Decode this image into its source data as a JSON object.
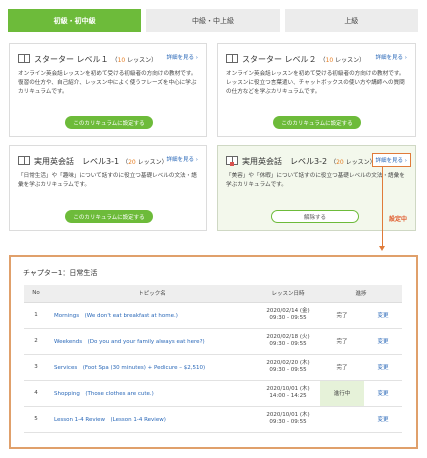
{
  "tabs": [
    {
      "label": "初級・初中級",
      "active": true
    },
    {
      "label": "中級・中上級",
      "active": false
    },
    {
      "label": "上級",
      "active": false
    }
  ],
  "cards": [
    {
      "title": "スターター レベル１",
      "lessons_open": "（",
      "lessons_num": "10",
      "lessons_close": " レッスン）",
      "detail": "詳細を見る ›",
      "desc": "オンライン英会話レッスンを初めて受ける初級者の方向けの教材です。復習の仕方や、自己紹介、レッスン中によく使うフレーズを中心に学ぶカリキュラムです。",
      "button": "このカリキュラムに設定する"
    },
    {
      "title": "スターター レベル２",
      "lessons_open": "（",
      "lessons_num": "10",
      "lessons_close": " レッスン）",
      "detail": "詳細を見る ›",
      "desc": "オンライン英会話レッスンを初めて受ける初級者の方向けの教材です。レッスンに役立つ言葉遣い、チャットボックスの使い方や講師への質問の仕方などを学ぶカリキュラムです。",
      "button": "このカリキュラムに設定する"
    },
    {
      "title": "実用英会話　レベル3-1",
      "lessons_open": "（",
      "lessons_num": "20",
      "lessons_close": " レッスン）",
      "detail": "詳細を見る ›",
      "desc": "「日常生活」や「趣味」について話すのに役立つ基礎レベルの文法・語彙を学ぶカリキュラムです。",
      "button": "このカリキュラムに設定する"
    },
    {
      "title": "実用英会話　レベル3-2",
      "lessons_open": "（",
      "lessons_num": "20",
      "lessons_close": " レッスン）",
      "detail": "詳細を見る ›",
      "desc": "「美容」や「休暇」について話すのに役立つ基礎レベルの文法・語彙を学ぶカリキュラムです。",
      "button": "解除する"
    }
  ],
  "set_badge": "設定中",
  "chapter": {
    "title": "チャプター1：日常生活",
    "headers": [
      "No",
      "トピック名",
      "レッスン日時",
      "進捗"
    ],
    "rows": [
      {
        "no": "1",
        "topic": "Mornings　(We don't eat breakfast at home.)",
        "date1": "2020/02/14 (金)",
        "date2": "09:30 - 09:55",
        "status": "完了",
        "change": "変更"
      },
      {
        "no": "2",
        "topic": "Weekends　(Do you and your family always eat here?)",
        "date1": "2020/02/18 (火)",
        "date2": "09:30 - 09:55",
        "status": "完了",
        "change": "変更"
      },
      {
        "no": "3",
        "topic": "Services　(Foot Spa (30 minutes) + Pedicure – $2,510)",
        "date1": "2020/02/20 (木)",
        "date2": "09:30 - 09:55",
        "status": "完了",
        "change": "変更"
      },
      {
        "no": "4",
        "topic": "Shopping　(Those clothes are cute.)",
        "date1": "2020/10/01 (木)",
        "date2": "14:00 - 14:25",
        "status": "進行中",
        "change": "変更"
      },
      {
        "no": "5",
        "topic": "Lesson 1-4 Review　(Lesson 1-4 Review)",
        "date1": "2020/10/01 (木)",
        "date2": "09:30 - 09:55",
        "status": "",
        "change": "変更"
      }
    ]
  },
  "colors": {
    "accent": "#6dbb3a",
    "link": "#2a68b8",
    "highlight": "#e07b39",
    "lesson_count": "#e67e22"
  }
}
